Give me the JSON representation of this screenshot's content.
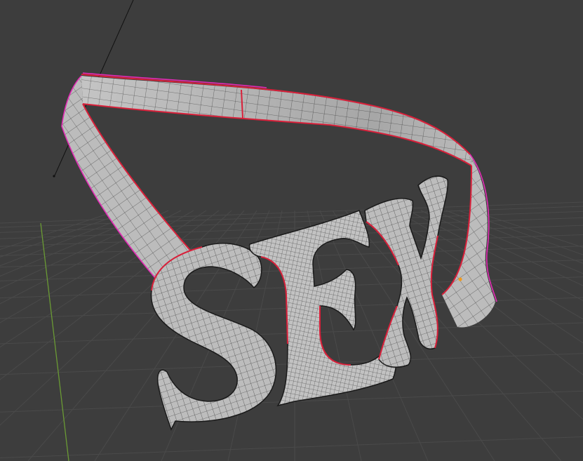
{
  "viewport": {
    "background_color": "#3d3d3d",
    "grid_color": "#4a4a4a",
    "y_axis_color": "#6a9a34",
    "mesh_surface_color": "#bdbdbd",
    "wireframe_color": "#1a1a1a",
    "selected_edge_color": "#d9203a",
    "seam_edge_color": "#e22bb4",
    "origin_point_color": "#f29a1e"
  },
  "scene": {
    "object": "strap-mesh",
    "mesh_letters": [
      "S",
      "E",
      "X"
    ]
  }
}
